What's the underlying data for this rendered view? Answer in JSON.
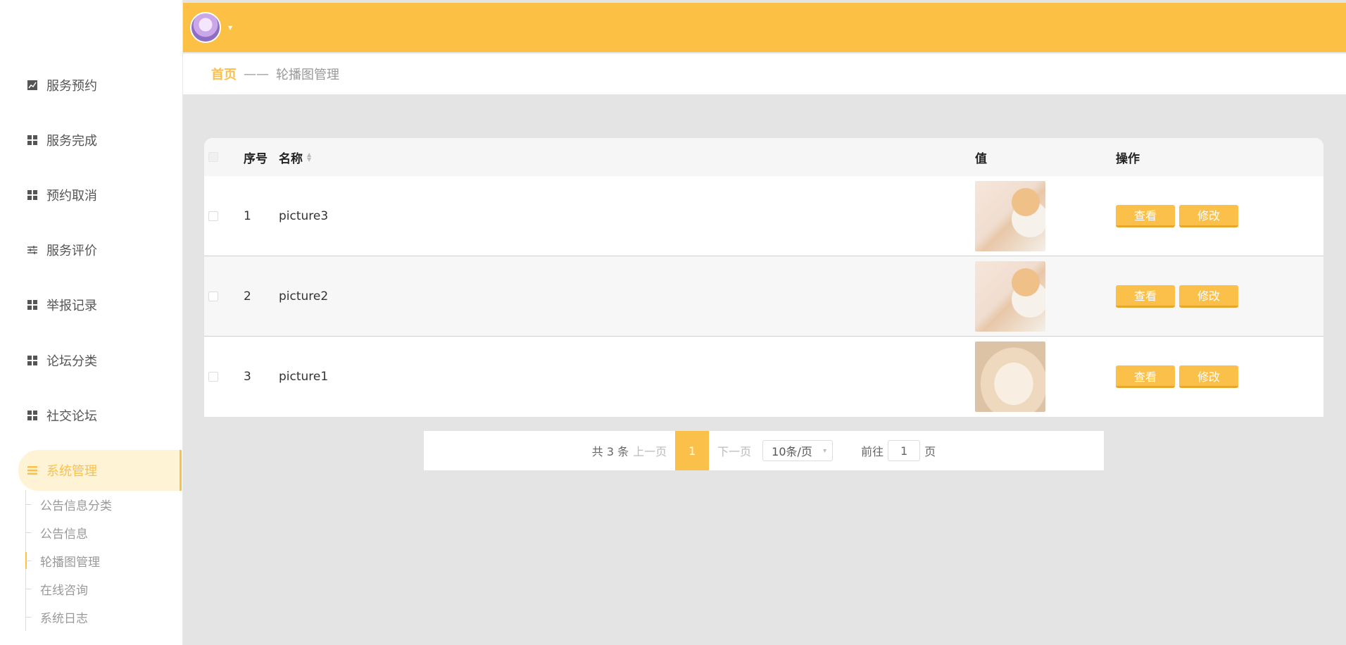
{
  "sidebar": {
    "items": [
      {
        "label": "服务预约",
        "icon": "chart-icon"
      },
      {
        "label": "服务完成",
        "icon": "grid-icon"
      },
      {
        "label": "预约取消",
        "icon": "grid-icon"
      },
      {
        "label": "服务评价",
        "icon": "sliders-icon"
      },
      {
        "label": "举报记录",
        "icon": "grid-icon"
      },
      {
        "label": "论坛分类",
        "icon": "grid-icon"
      },
      {
        "label": "社交论坛",
        "icon": "grid-icon"
      },
      {
        "label": "系统管理",
        "icon": "menu-icon"
      }
    ],
    "sub_items": [
      {
        "label": "公告信息分类"
      },
      {
        "label": "公告信息"
      },
      {
        "label": "轮播图管理"
      },
      {
        "label": "在线咨询"
      },
      {
        "label": "系统日志"
      }
    ]
  },
  "header": {
    "caret": "▾"
  },
  "breadcrumb": {
    "home": "首页",
    "separator": "——",
    "current": "轮播图管理"
  },
  "table": {
    "columns": {
      "index": "序号",
      "name": "名称",
      "value": "值",
      "actions": "操作"
    },
    "rows": [
      {
        "index": "1",
        "name": "picture3",
        "image": "dog"
      },
      {
        "index": "2",
        "name": "picture2",
        "image": "dog"
      },
      {
        "index": "3",
        "name": "picture1",
        "image": "cat"
      }
    ],
    "view_label": "查看",
    "edit_label": "修改"
  },
  "pagination": {
    "total": "共 3 条",
    "prev": "上一页",
    "current": "1",
    "next": "下一页",
    "page_size": "10条/页",
    "goto_label": "前往",
    "goto_value": "1",
    "page_unit": "页"
  },
  "colors": {
    "accent": "#fcc045",
    "background": "#e4e4e4"
  }
}
